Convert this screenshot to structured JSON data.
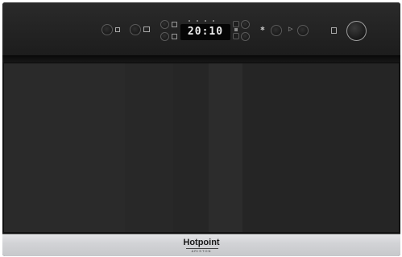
{
  "appliance": {
    "type": "built-in microwave oven",
    "color_body": "#1c1c1c",
    "color_steel": "#d2d3d6"
  },
  "display": {
    "time": "20:10"
  },
  "branding": {
    "brand": "Hotpoint",
    "sub_brand": "ARISTON"
  },
  "controls": {
    "icons": [
      "power-icon",
      "grill-icon",
      "defrost-icon",
      "program-icon",
      "plus-icon",
      "minus-icon",
      "star-icon",
      "play-icon",
      "stop-icon",
      "door-open-icon"
    ]
  }
}
